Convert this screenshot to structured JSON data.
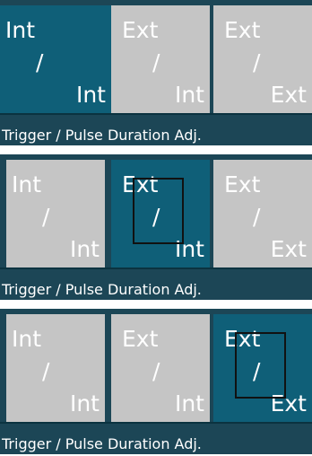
{
  "panels": [
    {
      "selected": 0,
      "options": [
        {
          "top": "Int",
          "slash": "/",
          "bottom": "Int"
        },
        {
          "top": "Ext",
          "slash": "/",
          "bottom": "Int"
        },
        {
          "top": "Ext",
          "slash": "/",
          "bottom": "Ext"
        }
      ],
      "caption": "Trigger / Pulse Duration Adj."
    },
    {
      "selected": 1,
      "options": [
        {
          "top": "Int",
          "slash": "/",
          "bottom": "Int"
        },
        {
          "top": "Ext",
          "slash": "/",
          "bottom": "Int"
        },
        {
          "top": "Ext",
          "slash": "/",
          "bottom": "Ext"
        }
      ],
      "caption": "Trigger / Pulse Duration Adj."
    },
    {
      "selected": 2,
      "options": [
        {
          "top": "Int",
          "slash": "/",
          "bottom": "Int"
        },
        {
          "top": "Ext",
          "slash": "/",
          "bottom": "Int"
        },
        {
          "top": "Ext",
          "slash": "/",
          "bottom": "Ext"
        }
      ],
      "caption": "Trigger / Pulse Duration Adj."
    }
  ],
  "colors": {
    "background": "#1c4656",
    "selected": "#0f5f78",
    "unselected": "#c5c5c5",
    "text": "#ffffff"
  }
}
